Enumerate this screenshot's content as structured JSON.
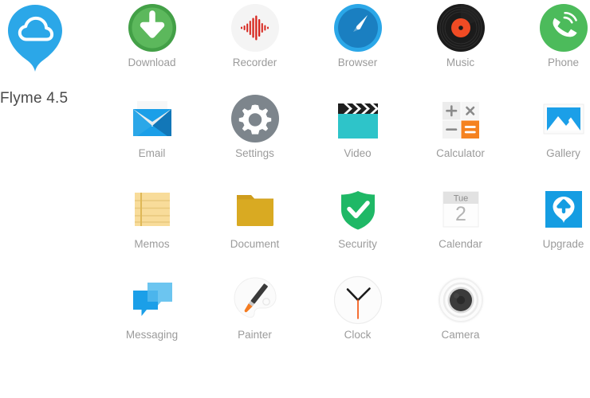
{
  "brand": {
    "name": "Flyme 4.5",
    "logo_icon": "cloud-balloon-icon",
    "logo_color": "#2ba7e8",
    "name_color": "#4a4a4a"
  },
  "palette": {
    "background": "#ffffff",
    "label": "#9b9b9b",
    "green": "#4caf50",
    "green_dark": "#43a047",
    "red": "#e02b20",
    "blue": "#1b8fd4",
    "blue_light": "#2ba7e8",
    "black": "#1c1c1c",
    "orange": "#f47b20",
    "teal": "#2ec4c9",
    "gold": "#d9a521",
    "yellow_light": "#f7d88f",
    "gray": "#7e848a",
    "gray_light": "#f2f2f2"
  },
  "grid": {
    "columns": 5,
    "rows": 4,
    "apps": [
      {
        "label": "Download",
        "icon": "download-arrow-icon",
        "row": 0,
        "col": 0
      },
      {
        "label": "Recorder",
        "icon": "waveform-icon",
        "row": 0,
        "col": 1
      },
      {
        "label": "Browser",
        "icon": "compass-icon",
        "row": 0,
        "col": 2
      },
      {
        "label": "Music",
        "icon": "vinyl-record-icon",
        "row": 0,
        "col": 3
      },
      {
        "label": "Phone",
        "icon": "phone-handset-icon",
        "row": 0,
        "col": 4
      },
      {
        "label": "Email",
        "icon": "envelope-icon",
        "row": 1,
        "col": 0
      },
      {
        "label": "Settings",
        "icon": "gear-icon",
        "row": 1,
        "col": 1
      },
      {
        "label": "Video",
        "icon": "clapperboard-icon",
        "row": 1,
        "col": 2
      },
      {
        "label": "Calculator",
        "icon": "calculator-keys-icon",
        "row": 1,
        "col": 3
      },
      {
        "label": "Gallery",
        "icon": "mountain-photo-icon",
        "row": 1,
        "col": 4
      },
      {
        "label": "Memos",
        "icon": "notepad-icon",
        "row": 2,
        "col": 0
      },
      {
        "label": "Document",
        "icon": "folder-icon",
        "row": 2,
        "col": 1
      },
      {
        "label": "Security",
        "icon": "shield-check-icon",
        "row": 2,
        "col": 2
      },
      {
        "label": "Calendar",
        "icon": "calendar-icon",
        "row": 2,
        "col": 3
      },
      {
        "label": "Upgrade",
        "icon": "upgrade-balloon-icon",
        "row": 2,
        "col": 4
      },
      {
        "label": "Messaging",
        "icon": "speech-bubbles-icon",
        "row": 3,
        "col": 0
      },
      {
        "label": "Painter",
        "icon": "paintbrush-icon",
        "row": 3,
        "col": 1
      },
      {
        "label": "Clock",
        "icon": "analog-clock-icon",
        "row": 3,
        "col": 2
      },
      {
        "label": "Camera",
        "icon": "camera-lens-icon",
        "row": 3,
        "col": 3
      }
    ]
  },
  "calendar_icon": {
    "weekday": "Tue",
    "day": "2"
  },
  "calculator_icon": {
    "keys": [
      "+",
      "×",
      "−",
      "="
    ]
  }
}
